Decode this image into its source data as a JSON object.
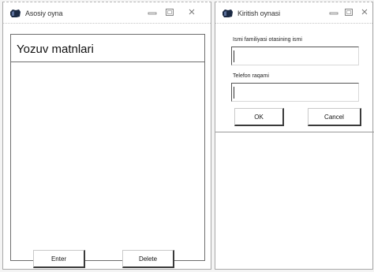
{
  "main_window": {
    "title": "Asosiy oyna",
    "textbox_header": "Yozuv matnlari",
    "enter_label": "Enter",
    "delete_label": "Delete"
  },
  "input_window": {
    "title": "Kiritish oynasi",
    "name_label": "Ismi familiyasi otasining ismi",
    "name_value": "",
    "phone_label": "Telefon raqami",
    "phone_value": "",
    "ok_label": "OK",
    "cancel_label": "Cancel"
  }
}
